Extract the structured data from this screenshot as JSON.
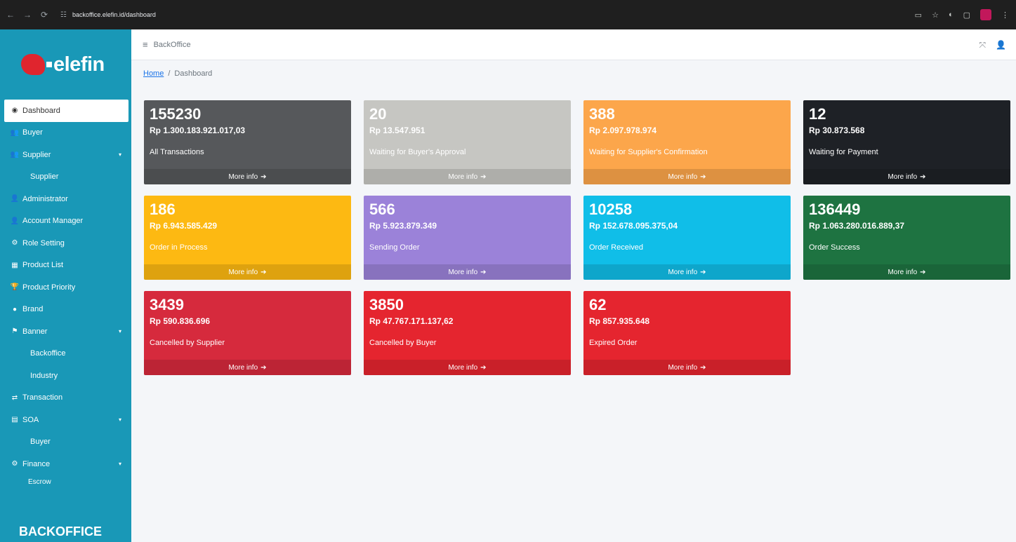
{
  "browser": {
    "url": "backoffice.elefin.id/dashboard",
    "nav_back": "←",
    "nav_forward": "→",
    "nav_reload": "⟳",
    "tune_icon": "☷"
  },
  "brand": {
    "logo_text": "elefin",
    "footer": "BACKOFFICE",
    "color": "#1998b7"
  },
  "sidebar": {
    "items": [
      {
        "label": "Dashboard",
        "icon": "◉",
        "type": "active"
      },
      {
        "label": "Buyer",
        "icon": "👥",
        "type": "item"
      },
      {
        "label": "Supplier",
        "icon": "👥",
        "type": "item",
        "caret": "▾"
      },
      {
        "label": "Supplier",
        "icon": "",
        "type": "sub"
      },
      {
        "label": "Administrator",
        "icon": "👤",
        "type": "item"
      },
      {
        "label": "Account Manager",
        "icon": "👤",
        "type": "item"
      },
      {
        "label": "Role Setting",
        "icon": "⚙",
        "type": "item"
      },
      {
        "label": "Product List",
        "icon": "▦",
        "type": "item"
      },
      {
        "label": "Product Priority",
        "icon": "🏆",
        "type": "item"
      },
      {
        "label": "Brand",
        "icon": "●",
        "type": "item"
      },
      {
        "label": "Banner",
        "icon": "⚑",
        "type": "item",
        "caret": "▾"
      },
      {
        "label": "Backoffice",
        "icon": "",
        "type": "sub"
      },
      {
        "label": "Industry",
        "icon": "",
        "type": "sub"
      },
      {
        "label": "Transaction",
        "icon": "⇄",
        "type": "item"
      },
      {
        "label": "SOA",
        "icon": "▤",
        "type": "item",
        "caret": "▾"
      },
      {
        "label": "Buyer",
        "icon": "",
        "type": "sub"
      },
      {
        "label": "Finance",
        "icon": "⚙",
        "type": "item",
        "caret": "▾"
      },
      {
        "label": "Escrow",
        "icon": "",
        "type": "tiny"
      }
    ]
  },
  "topbar": {
    "menu_icon": "≡",
    "title": "BackOffice",
    "fullscreen_icon": "⤧",
    "user_icon": "👤"
  },
  "breadcrumb": {
    "home": "Home",
    "separator": "/",
    "current": "Dashboard"
  },
  "cards": [
    {
      "count": "155230",
      "amount": "Rp 1.300.183.921.017,03",
      "label": "All Transactions",
      "more": "More info",
      "color": "#56585b"
    },
    {
      "count": "20",
      "amount": "Rp 13.547.951",
      "label": "Waiting for Buyer's Approval",
      "more": "More info",
      "color": "#c6c6c2"
    },
    {
      "count": "388",
      "amount": "Rp 2.097.978.974",
      "label": "Waiting for Supplier's Confirmation",
      "more": "More info",
      "color": "#fca64b"
    },
    {
      "count": "12",
      "amount": "Rp 30.873.568",
      "label": "Waiting for Payment",
      "more": "More info",
      "color": "#1e2126"
    },
    {
      "count": "186",
      "amount": "Rp 6.943.585.429",
      "label": "Order in Process",
      "more": "More info",
      "color": "#fdb912"
    },
    {
      "count": "566",
      "amount": "Rp 5.923.879.349",
      "label": "Sending Order",
      "more": "More info",
      "color": "#9b82d9"
    },
    {
      "count": "10258",
      "amount": "Rp 152.678.095.375,04",
      "label": "Order Received",
      "more": "More info",
      "color": "#10bee8"
    },
    {
      "count": "136449",
      "amount": "Rp 1.063.280.016.889,37",
      "label": "Order Success",
      "more": "More info",
      "color": "#1e7341"
    },
    {
      "count": "3439",
      "amount": "Rp 590.836.696",
      "label": "Cancelled by Supplier",
      "more": "More info",
      "color": "#d62a3d"
    },
    {
      "count": "3850",
      "amount": "Rp 47.767.171.137,62",
      "label": "Cancelled by Buyer",
      "more": "More info",
      "color": "#e5252f"
    },
    {
      "count": "62",
      "amount": "Rp 857.935.648",
      "label": "Expired Order",
      "more": "More info",
      "color": "#e5252f"
    }
  ]
}
